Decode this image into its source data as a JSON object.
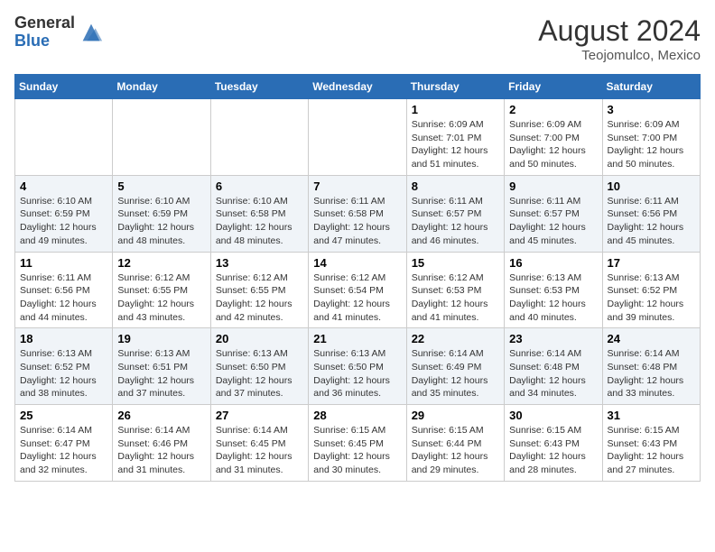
{
  "header": {
    "logo_general": "General",
    "logo_blue": "Blue",
    "month_year": "August 2024",
    "location": "Teojomulco, Mexico"
  },
  "calendar": {
    "days_of_week": [
      "Sunday",
      "Monday",
      "Tuesday",
      "Wednesday",
      "Thursday",
      "Friday",
      "Saturday"
    ],
    "weeks": [
      [
        {
          "day": "",
          "info": ""
        },
        {
          "day": "",
          "info": ""
        },
        {
          "day": "",
          "info": ""
        },
        {
          "day": "",
          "info": ""
        },
        {
          "day": "1",
          "info": "Sunrise: 6:09 AM\nSunset: 7:01 PM\nDaylight: 12 hours\nand 51 minutes."
        },
        {
          "day": "2",
          "info": "Sunrise: 6:09 AM\nSunset: 7:00 PM\nDaylight: 12 hours\nand 50 minutes."
        },
        {
          "day": "3",
          "info": "Sunrise: 6:09 AM\nSunset: 7:00 PM\nDaylight: 12 hours\nand 50 minutes."
        }
      ],
      [
        {
          "day": "4",
          "info": "Sunrise: 6:10 AM\nSunset: 6:59 PM\nDaylight: 12 hours\nand 49 minutes."
        },
        {
          "day": "5",
          "info": "Sunrise: 6:10 AM\nSunset: 6:59 PM\nDaylight: 12 hours\nand 48 minutes."
        },
        {
          "day": "6",
          "info": "Sunrise: 6:10 AM\nSunset: 6:58 PM\nDaylight: 12 hours\nand 48 minutes."
        },
        {
          "day": "7",
          "info": "Sunrise: 6:11 AM\nSunset: 6:58 PM\nDaylight: 12 hours\nand 47 minutes."
        },
        {
          "day": "8",
          "info": "Sunrise: 6:11 AM\nSunset: 6:57 PM\nDaylight: 12 hours\nand 46 minutes."
        },
        {
          "day": "9",
          "info": "Sunrise: 6:11 AM\nSunset: 6:57 PM\nDaylight: 12 hours\nand 45 minutes."
        },
        {
          "day": "10",
          "info": "Sunrise: 6:11 AM\nSunset: 6:56 PM\nDaylight: 12 hours\nand 45 minutes."
        }
      ],
      [
        {
          "day": "11",
          "info": "Sunrise: 6:11 AM\nSunset: 6:56 PM\nDaylight: 12 hours\nand 44 minutes."
        },
        {
          "day": "12",
          "info": "Sunrise: 6:12 AM\nSunset: 6:55 PM\nDaylight: 12 hours\nand 43 minutes."
        },
        {
          "day": "13",
          "info": "Sunrise: 6:12 AM\nSunset: 6:55 PM\nDaylight: 12 hours\nand 42 minutes."
        },
        {
          "day": "14",
          "info": "Sunrise: 6:12 AM\nSunset: 6:54 PM\nDaylight: 12 hours\nand 41 minutes."
        },
        {
          "day": "15",
          "info": "Sunrise: 6:12 AM\nSunset: 6:53 PM\nDaylight: 12 hours\nand 41 minutes."
        },
        {
          "day": "16",
          "info": "Sunrise: 6:13 AM\nSunset: 6:53 PM\nDaylight: 12 hours\nand 40 minutes."
        },
        {
          "day": "17",
          "info": "Sunrise: 6:13 AM\nSunset: 6:52 PM\nDaylight: 12 hours\nand 39 minutes."
        }
      ],
      [
        {
          "day": "18",
          "info": "Sunrise: 6:13 AM\nSunset: 6:52 PM\nDaylight: 12 hours\nand 38 minutes."
        },
        {
          "day": "19",
          "info": "Sunrise: 6:13 AM\nSunset: 6:51 PM\nDaylight: 12 hours\nand 37 minutes."
        },
        {
          "day": "20",
          "info": "Sunrise: 6:13 AM\nSunset: 6:50 PM\nDaylight: 12 hours\nand 37 minutes."
        },
        {
          "day": "21",
          "info": "Sunrise: 6:13 AM\nSunset: 6:50 PM\nDaylight: 12 hours\nand 36 minutes."
        },
        {
          "day": "22",
          "info": "Sunrise: 6:14 AM\nSunset: 6:49 PM\nDaylight: 12 hours\nand 35 minutes."
        },
        {
          "day": "23",
          "info": "Sunrise: 6:14 AM\nSunset: 6:48 PM\nDaylight: 12 hours\nand 34 minutes."
        },
        {
          "day": "24",
          "info": "Sunrise: 6:14 AM\nSunset: 6:48 PM\nDaylight: 12 hours\nand 33 minutes."
        }
      ],
      [
        {
          "day": "25",
          "info": "Sunrise: 6:14 AM\nSunset: 6:47 PM\nDaylight: 12 hours\nand 32 minutes."
        },
        {
          "day": "26",
          "info": "Sunrise: 6:14 AM\nSunset: 6:46 PM\nDaylight: 12 hours\nand 31 minutes."
        },
        {
          "day": "27",
          "info": "Sunrise: 6:14 AM\nSunset: 6:45 PM\nDaylight: 12 hours\nand 31 minutes."
        },
        {
          "day": "28",
          "info": "Sunrise: 6:15 AM\nSunset: 6:45 PM\nDaylight: 12 hours\nand 30 minutes."
        },
        {
          "day": "29",
          "info": "Sunrise: 6:15 AM\nSunset: 6:44 PM\nDaylight: 12 hours\nand 29 minutes."
        },
        {
          "day": "30",
          "info": "Sunrise: 6:15 AM\nSunset: 6:43 PM\nDaylight: 12 hours\nand 28 minutes."
        },
        {
          "day": "31",
          "info": "Sunrise: 6:15 AM\nSunset: 6:43 PM\nDaylight: 12 hours\nand 27 minutes."
        }
      ]
    ]
  }
}
